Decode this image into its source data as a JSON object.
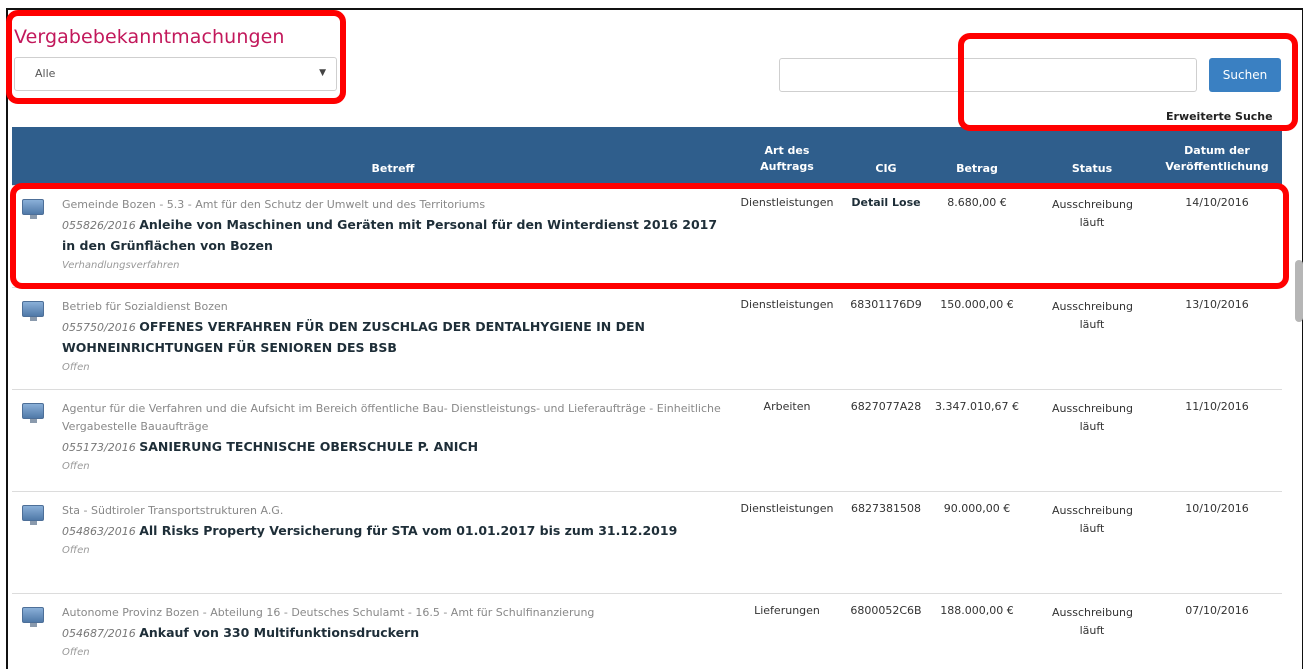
{
  "header": {
    "title": "Vergabebekanntmachungen",
    "filter_value": "Alle",
    "search_value": "",
    "search_button": "Suchen",
    "advanced_search": "Erweiterte Suche"
  },
  "colors": {
    "title": "#c2185b",
    "header_bg": "#2f5e8c",
    "button": "#3a80c2",
    "highlight": "#ff0000"
  },
  "table": {
    "columns": {
      "subject": "Betreff",
      "type": "Art des Auftrags",
      "cig": "CIG",
      "amount": "Betrag",
      "status": "Status",
      "date": "Datum der Veröffentlichung"
    },
    "rows": [
      {
        "icon": "monitor-icon",
        "org": "Gemeinde Bozen - 5.3 - Amt für den Schutz der Umwelt und des Territoriums",
        "number": "055826/2016",
        "subject": "Anleihe von Maschinen und Geräten mit Personal für den Winterdienst 2016 2017 in den Grünflächen von Bozen",
        "procedure": "Verhandlungsverfahren",
        "type": "Dienstleistungen",
        "cig": "Detail Lose",
        "amount": "8.680,00 €",
        "status": "Ausschreibung läuft",
        "date": "14/10/2016"
      },
      {
        "icon": "monitor-icon",
        "org": "Betrieb für Sozialdienst Bozen",
        "number": "055750/2016",
        "subject": "OFFENES VERFAHREN FÜR DEN ZUSCHLAG DER DENTALHYGIENE IN DEN WOHNEINRICHTUNGEN FÜR SENIOREN DES BSB",
        "procedure": "Offen",
        "type": "Dienstleistungen",
        "cig": "68301176D9",
        "amount": "150.000,00 €",
        "status": "Ausschreibung läuft",
        "date": "13/10/2016"
      },
      {
        "icon": "monitor-icon",
        "org": "Agentur für die Verfahren und die Aufsicht im Bereich öffentliche Bau- Dienstleistungs- und Lieferaufträge - Einheitliche Vergabestelle Bauaufträge",
        "number": "055173/2016",
        "subject": "SANIERUNG TECHNISCHE OBERSCHULE P. ANICH",
        "procedure": "Offen",
        "type": "Arbeiten",
        "cig": "6827077A28",
        "amount": "3.347.010,67 €",
        "status": "Ausschreibung läuft",
        "date": "11/10/2016"
      },
      {
        "icon": "monitor-icon",
        "org": "Sta - Südtiroler Transportstrukturen A.G.",
        "number": "054863/2016",
        "subject": "All Risks Property Versicherung für STA vom 01.01.2017 bis zum 31.12.2019",
        "procedure": "Offen",
        "type": "Dienstleistungen",
        "cig": "6827381508",
        "amount": "90.000,00 €",
        "status": "Ausschreibung läuft",
        "date": "10/10/2016"
      },
      {
        "icon": "monitor-icon",
        "org": "Autonome Provinz Bozen - Abteilung 16 - Deutsches Schulamt - 16.5 - Amt für Schulfinanzierung",
        "number": "054687/2016",
        "subject": "Ankauf von 330 Multifunktionsdruckern",
        "procedure": "Offen",
        "type": "Lieferungen",
        "cig": "6800052C6B",
        "amount": "188.000,00 €",
        "status": "Ausschreibung läuft",
        "date": "07/10/2016"
      }
    ]
  }
}
